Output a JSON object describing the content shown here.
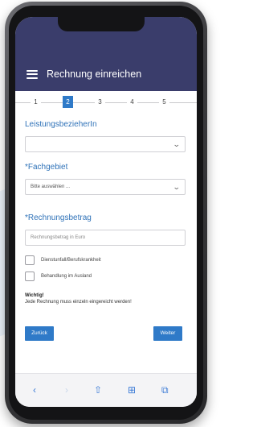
{
  "app": {
    "title": "Rechnung einreichen"
  },
  "steps": [
    "1",
    "2",
    "3",
    "4",
    "5"
  ],
  "active_step": "2",
  "form": {
    "leistungsbezieher": {
      "label": "LeistungsbezieherIn",
      "value": ""
    },
    "fachgebiet": {
      "label": "*Fachgebiet",
      "value": "Bitte auswählen ..."
    },
    "rechnungsbetrag": {
      "label": "*Rechnungsbetrag",
      "placeholder": "Rechnungsbetrag in Euro"
    },
    "checkboxes": [
      "Dienstunfall/Berufskrankheit",
      "Behandlung im Ausland"
    ]
  },
  "notice": {
    "title": "Wichtig!",
    "text": "Jede Rechnung muss einzeln eingereicht werden!"
  },
  "buttons": {
    "back": "Zurück",
    "next": "Weiter"
  },
  "toolbar_icons": [
    "back-arrow-icon",
    "forward-arrow-icon",
    "share-icon",
    "bookmarks-icon",
    "tabs-icon"
  ],
  "colors": {
    "header": "#3a3d6b",
    "accent": "#2f7ac8",
    "label": "#2f72b8",
    "toolbar_icon": "#3c7bd6"
  }
}
